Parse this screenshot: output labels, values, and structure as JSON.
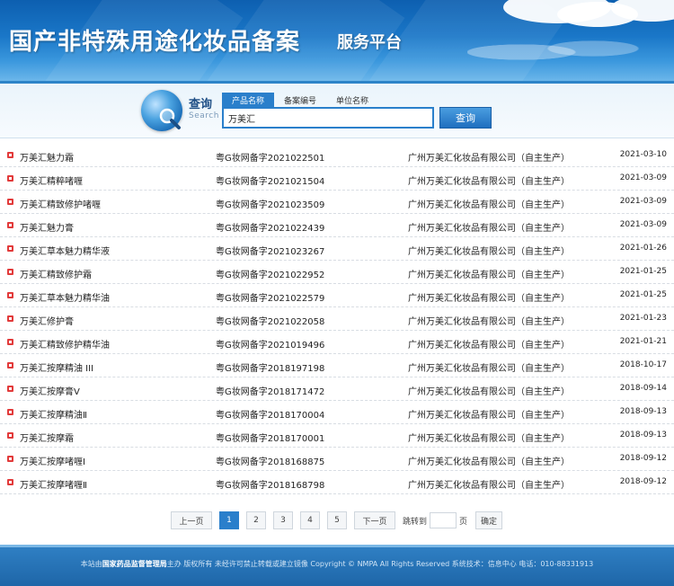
{
  "header": {
    "title": "国产非特殊用途化妆品备案",
    "subtitle": "服务平台"
  },
  "search": {
    "label": "查询",
    "label_en": "Search",
    "tabs": [
      {
        "label": "产品名称",
        "active": true
      },
      {
        "label": "备案编号",
        "active": false
      },
      {
        "label": "单位名称",
        "active": false
      }
    ],
    "value": "万美汇",
    "button_label": "查询"
  },
  "results": [
    {
      "name": "万美汇魅力霜",
      "record": "粤G妆网备字2021022501",
      "company": "广州万美汇化妆品有限公司（自主生产）",
      "date": "2021-03-10"
    },
    {
      "name": "万美汇精粹啫喱",
      "record": "粤G妆网备字2021021504",
      "company": "广州万美汇化妆品有限公司（自主生产）",
      "date": "2021-03-09"
    },
    {
      "name": "万美汇精致修护啫喱",
      "record": "粤G妆网备字2021023509",
      "company": "广州万美汇化妆品有限公司（自主生产）",
      "date": "2021-03-09"
    },
    {
      "name": "万美汇魅力膏",
      "record": "粤G妆网备字2021022439",
      "company": "广州万美汇化妆品有限公司（自主生产）",
      "date": "2021-03-09"
    },
    {
      "name": "万美汇草本魅力精华液",
      "record": "粤G妆网备字2021023267",
      "company": "广州万美汇化妆品有限公司（自主生产）",
      "date": "2021-01-26"
    },
    {
      "name": "万美汇精致修护霜",
      "record": "粤G妆网备字2021022952",
      "company": "广州万美汇化妆品有限公司（自主生产）",
      "date": "2021-01-25"
    },
    {
      "name": "万美汇草本魅力精华油",
      "record": "粤G妆网备字2021022579",
      "company": "广州万美汇化妆品有限公司（自主生产）",
      "date": "2021-01-25"
    },
    {
      "name": "万美汇修护膏",
      "record": "粤G妆网备字2021022058",
      "company": "广州万美汇化妆品有限公司（自主生产）",
      "date": "2021-01-23"
    },
    {
      "name": "万美汇精致修护精华油",
      "record": "粤G妆网备字2021019496",
      "company": "广州万美汇化妆品有限公司（自主生产）",
      "date": "2021-01-21"
    },
    {
      "name": "万美汇按摩精油 III",
      "record": "粤G妆网备字2018197198",
      "company": "广州万美汇化妆品有限公司（自主生产）",
      "date": "2018-10-17"
    },
    {
      "name": "万美汇按摩膏V",
      "record": "粤G妆网备字2018171472",
      "company": "广州万美汇化妆品有限公司（自主生产）",
      "date": "2018-09-14"
    },
    {
      "name": "万美汇按摩精油Ⅱ",
      "record": "粤G妆网备字2018170004",
      "company": "广州万美汇化妆品有限公司（自主生产）",
      "date": "2018-09-13"
    },
    {
      "name": "万美汇按摩霜",
      "record": "粤G妆网备字2018170001",
      "company": "广州万美汇化妆品有限公司（自主生产）",
      "date": "2018-09-13"
    },
    {
      "name": "万美汇按摩啫喱Ⅰ",
      "record": "粤G妆网备字2018168875",
      "company": "广州万美汇化妆品有限公司（自主生产）",
      "date": "2018-09-12"
    },
    {
      "name": "万美汇按摩啫喱Ⅱ",
      "record": "粤G妆网备字2018168798",
      "company": "广州万美汇化妆品有限公司（自主生产）",
      "date": "2018-09-12"
    }
  ],
  "pagination": {
    "prev_label": "上一页",
    "pages": [
      "1",
      "2",
      "3",
      "4",
      "5"
    ],
    "current": "1",
    "next_label": "下一页",
    "goto_label": "跳转到",
    "page_unit": "页",
    "confirm_label": "确定"
  },
  "footer": {
    "prefix": "本站由",
    "org": "国家药品监督管理局",
    "rest": "主办 版权所有 未经许可禁止转载或建立镜像 Copyright © NMPA All Rights Reserved 系统技术：信息中心 电话：010-88331913"
  }
}
